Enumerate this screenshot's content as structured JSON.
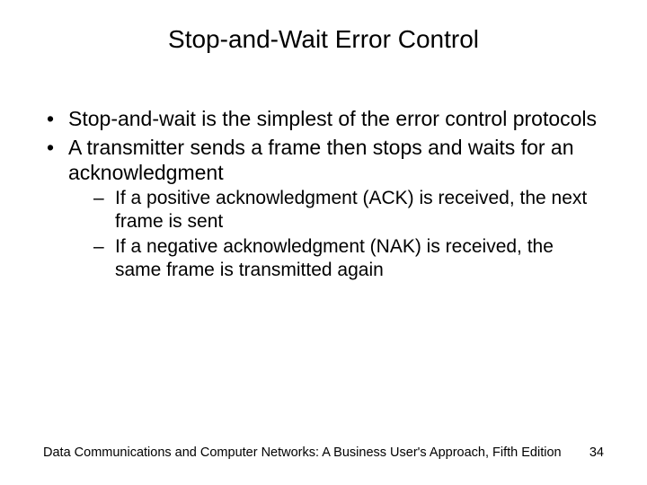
{
  "title": "Stop-and-Wait Error Control",
  "bullets": [
    {
      "text": "Stop-and-wait is the simplest of the error control protocols"
    },
    {
      "text": "A transmitter sends a frame then stops and waits for an acknowledgment",
      "sub": [
        "If a positive acknowledgment (ACK) is received, the next frame is sent",
        "If a negative acknowledgment (NAK) is received, the same frame is transmitted again"
      ]
    }
  ],
  "footer": {
    "source": "Data Communications and Computer Networks: A Business User's Approach, Fifth Edition",
    "page": "34"
  }
}
